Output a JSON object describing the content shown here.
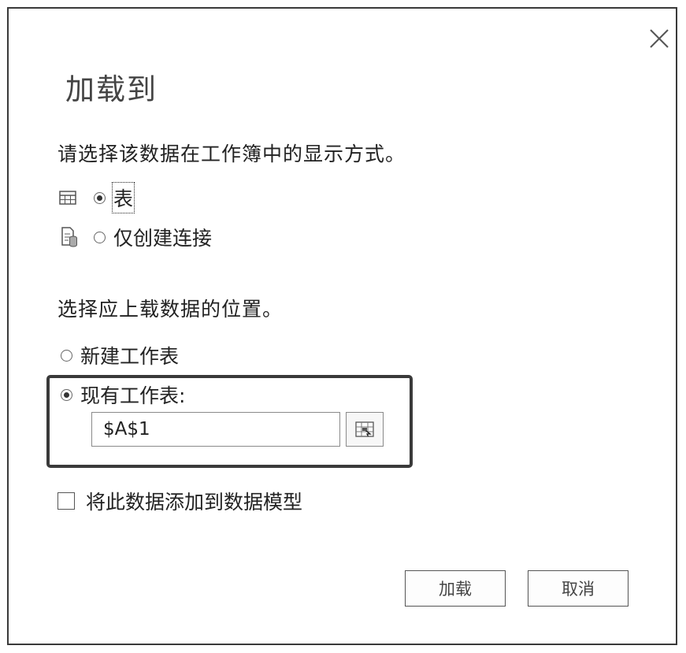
{
  "dialog": {
    "title": "加载到",
    "close_icon": "close-icon"
  },
  "display": {
    "label": "请选择该数据在工作簿中的显示方式。",
    "options": [
      {
        "label": "表",
        "icon": "table-icon",
        "selected": true
      },
      {
        "label": "仅创建连接",
        "icon": "connection-icon",
        "selected": false
      }
    ]
  },
  "location": {
    "label": "选择应上载数据的位置。",
    "options": [
      {
        "label": "新建工作表",
        "selected": false
      },
      {
        "label": "现有工作表:",
        "selected": true
      }
    ],
    "range_value": "$A$1",
    "range_picker_icon": "range-select-icon"
  },
  "data_model": {
    "label": "将此数据添加到数据模型",
    "checked": false
  },
  "buttons": {
    "load": "加载",
    "cancel": "取消"
  }
}
